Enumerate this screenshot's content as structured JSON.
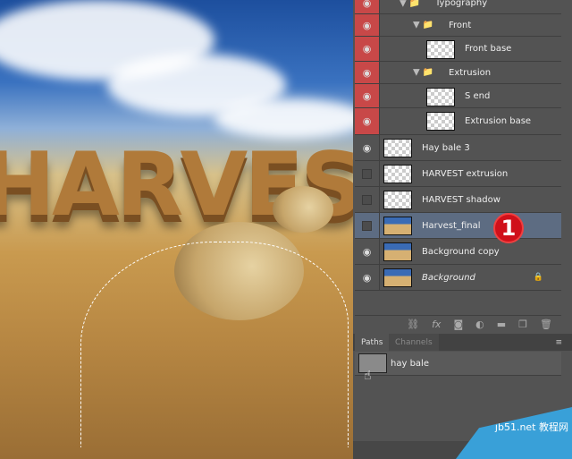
{
  "layers": [
    {
      "name": "Typography",
      "type": "group",
      "visible": true,
      "indent": 1
    },
    {
      "name": "Front",
      "type": "group",
      "visible": true,
      "indent": 2
    },
    {
      "name": "Front base",
      "type": "layer",
      "visible": true,
      "indent": 2
    },
    {
      "name": "Extrusion",
      "type": "group",
      "visible": true,
      "indent": 2
    },
    {
      "name": "S end",
      "type": "layer",
      "visible": true,
      "indent": 2
    },
    {
      "name": "Extrusion base",
      "type": "layer",
      "visible": true,
      "indent": 2
    },
    {
      "name": "Hay bale 3",
      "type": "layer",
      "visible": true,
      "indent": 0
    },
    {
      "name": "HARVEST extrusion",
      "type": "layer",
      "visible": false,
      "indent": 0
    },
    {
      "name": "HARVEST shadow",
      "type": "layer",
      "visible": false,
      "indent": 0
    },
    {
      "name": "Harvest_final",
      "type": "layer",
      "visible": false,
      "indent": 0,
      "selected": true
    },
    {
      "name": "Background copy",
      "type": "layer",
      "visible": true,
      "indent": 0
    },
    {
      "name": "Background",
      "type": "layer",
      "visible": true,
      "indent": 0,
      "locked": true
    }
  ],
  "canvas_text": "HARVEST",
  "badge": "1",
  "tabs": {
    "paths": "Paths",
    "channels": "Channels"
  },
  "paths": [
    {
      "name": "hay bale"
    }
  ],
  "toolbar": [
    "link-icon",
    "fx-icon",
    "mask-icon",
    "adjustment-icon",
    "folder-icon",
    "new-layer-icon",
    "trash-icon"
  ],
  "fx_label": "fx",
  "watermark": "jb51.net 教程网",
  "colors": {
    "visibility_highlight": "#c84848",
    "selected_row": "#5d6c82",
    "panel": "#535353"
  }
}
